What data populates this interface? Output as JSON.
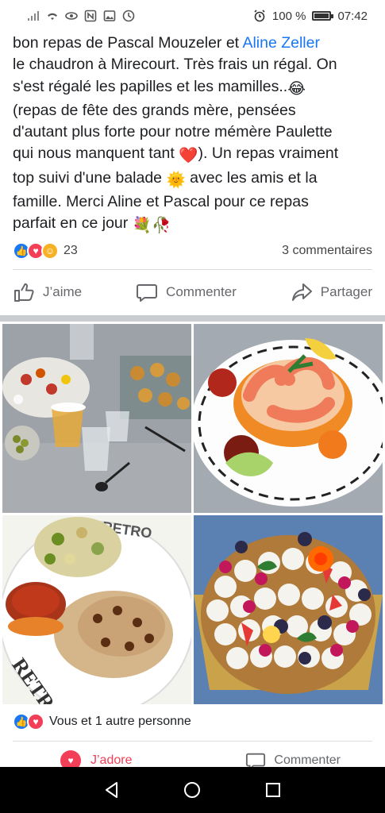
{
  "status_bar": {
    "battery_percent": "100 %",
    "time": "07:42",
    "battery_level": 1.0
  },
  "post": {
    "line1_prefix": "bon repas de Pascal Mouzeler et ",
    "mention": "Aline Zeller",
    "line2": "le chaudron à Mirecourt. Très frais un régal. On",
    "line3": "s'est régalé les papilles et les mamilles..",
    "line3_emoji": "😂",
    "line4": "(repas de fête des grands mère, pensées",
    "line5": "d'autant plus forte pour notre mémère Paulette",
    "line6": "qui nous manquent tant ",
    "line6_emoji": "❤️",
    "line6_end": "). Un repas vraiment",
    "line7_start": "top suivi d'une balade ",
    "line7_emoji": "🌞",
    "line7_end": " avec les amis et la",
    "line8": "famille. Merci Aline et Pascal pour ce repas",
    "line9": "parfait en ce jour ",
    "line9_emoji": "💐🥀"
  },
  "reactions": {
    "count": "23",
    "comments": "3 commentaires"
  },
  "actions": {
    "like": "J’aime",
    "comment": "Commenter",
    "share": "Partager"
  },
  "photo_reactions": {
    "label": "Vous et 1 autre personne"
  },
  "photo_actions": {
    "adore": "J’adore",
    "comment": "Commenter"
  },
  "colors": {
    "accent": "#1877f2",
    "love": "#f33e58",
    "care": "#f7b125"
  }
}
